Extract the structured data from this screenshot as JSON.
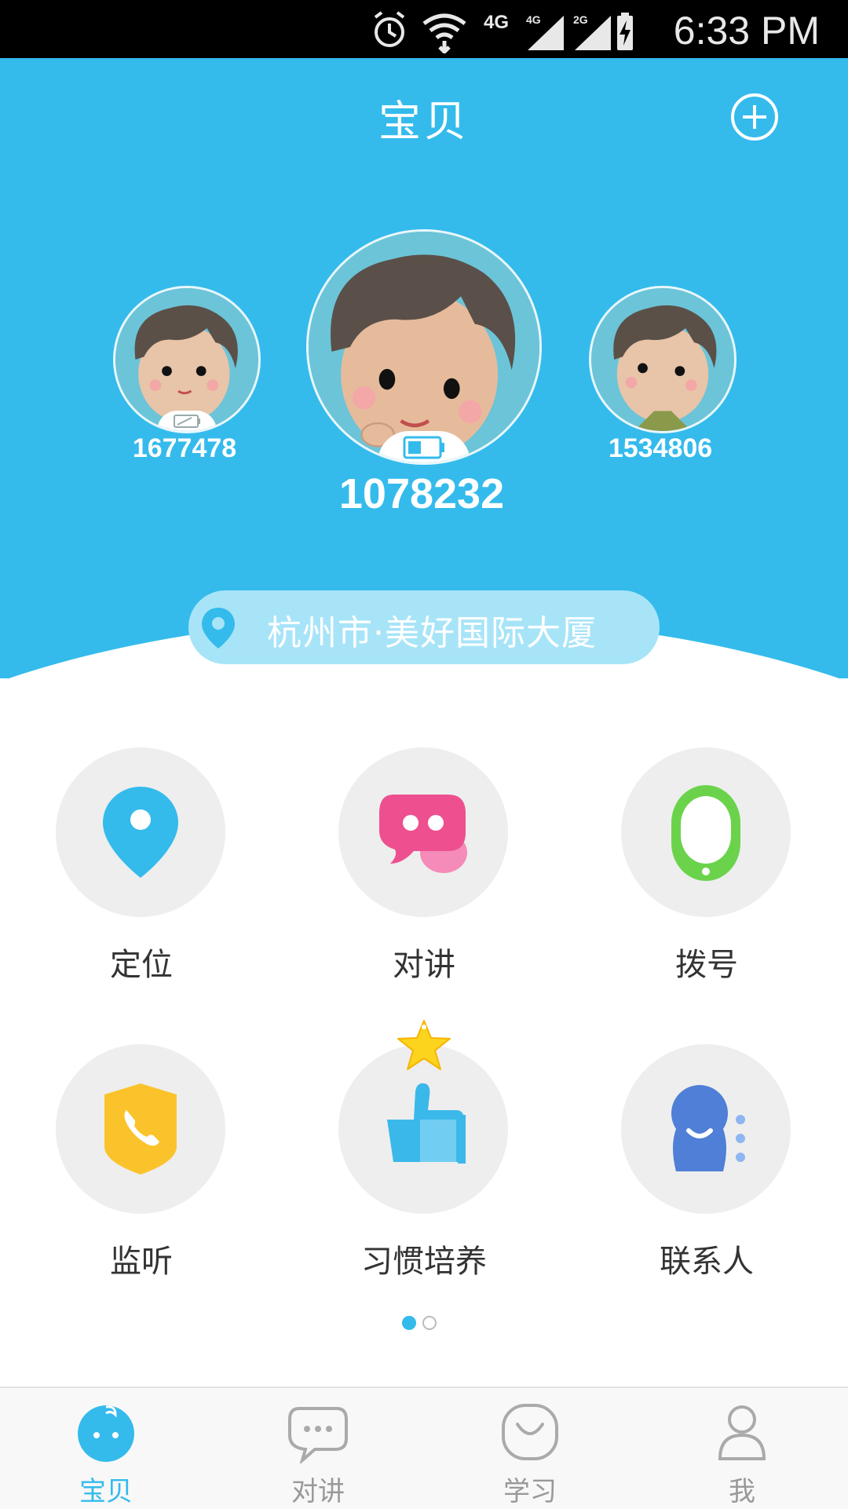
{
  "status_bar": {
    "time": "6:33 PM",
    "network_label": "4G",
    "sim1_label": "4G",
    "sim2_label": "2G",
    "icons": [
      "alarm-icon",
      "wifi-icon",
      "signal-4g-icon",
      "signal-2g-icon",
      "battery-charging-icon"
    ]
  },
  "header": {
    "title": "宝贝",
    "add_icon": "plus-circle-icon",
    "background": "#34bbec"
  },
  "babies": [
    {
      "id": "1677478",
      "battery": "low"
    },
    {
      "id": "1078232",
      "battery": "medium",
      "selected": true
    },
    {
      "id": "1534806",
      "battery": "unknown"
    }
  ],
  "location": {
    "text": "杭州市·美好国际大厦",
    "icon": "pin-icon"
  },
  "features": [
    {
      "label": "定位",
      "icon": "location-icon",
      "color": "#34bbec"
    },
    {
      "label": "对讲",
      "icon": "chat-bubble-icon",
      "color": "#ee4f8f"
    },
    {
      "label": "拨号",
      "icon": "watch-icon",
      "color": "#6bd34b"
    },
    {
      "label": "监听",
      "icon": "phone-shield-icon",
      "color": "#fbc32b"
    },
    {
      "label": "习惯培养",
      "icon": "thumbs-up-icon",
      "color": "#3bb8ea"
    },
    {
      "label": "联系人",
      "icon": "contact-icon",
      "color": "#4f7fd6"
    }
  ],
  "pager": {
    "pages": 2,
    "current": 1
  },
  "bottom_nav": [
    {
      "label": "宝贝",
      "icon": "baby-icon",
      "active": true
    },
    {
      "label": "对讲",
      "icon": "chat-icon",
      "active": false
    },
    {
      "label": "学习",
      "icon": "smile-icon",
      "active": false
    },
    {
      "label": "我",
      "icon": "person-icon",
      "active": false
    }
  ],
  "colors": {
    "accent": "#34bbec",
    "inactive": "#aaaaaa"
  }
}
